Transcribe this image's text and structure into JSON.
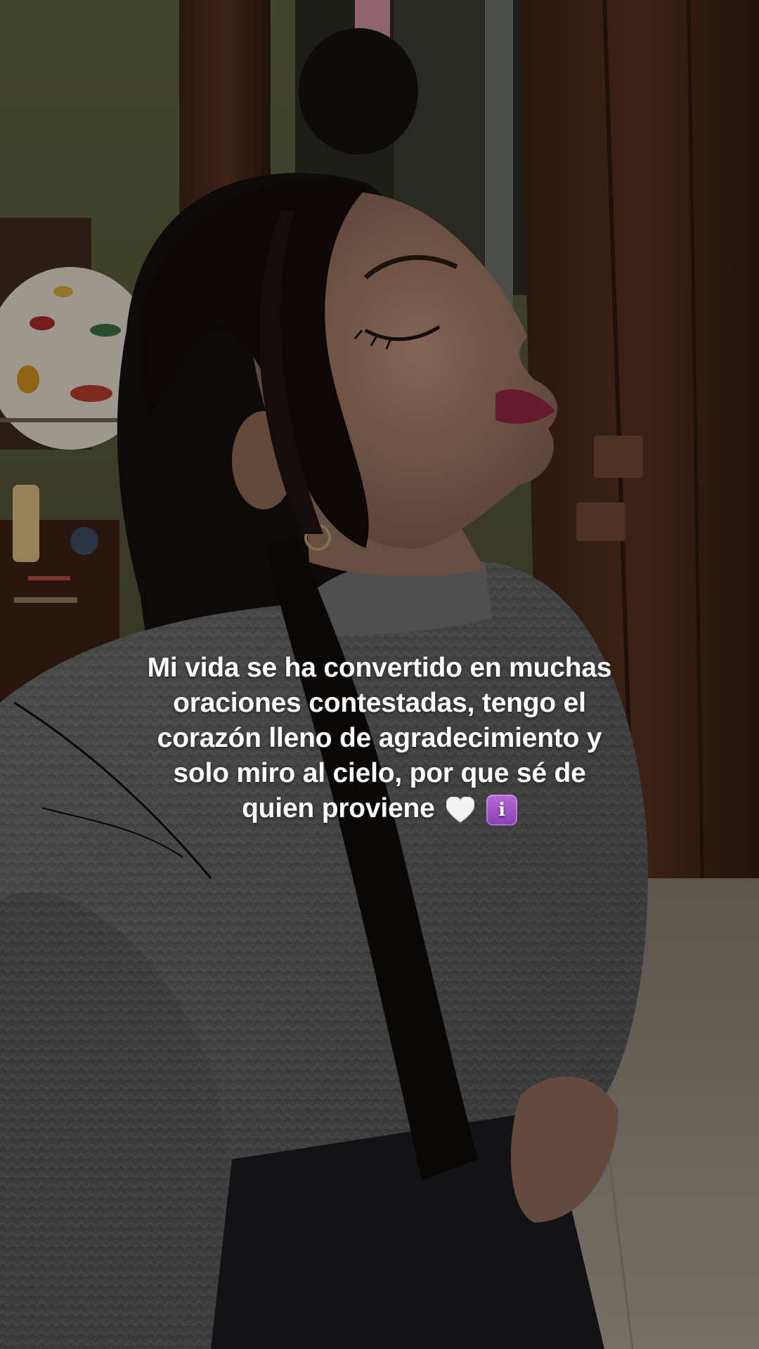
{
  "photo": {
    "scene": "photo-background",
    "palette": {
      "wall": "#565a3a",
      "curtain": "#4a2a1e",
      "sweater": "#5e5e5e",
      "hair": "#120d0c",
      "skin": "#a77f6c",
      "lips": "#8a2a44",
      "floor": "#8d867c"
    }
  },
  "caption": {
    "lines": [
      "Mi vida se ha convertido en muchas",
      "oraciones contestadas, tengo el",
      "corazón lleno de agradecimiento y",
      "solo miro al cielo, por que sé de",
      "quien proviene"
    ],
    "emojis": [
      "white-heart-icon",
      "info-icon"
    ],
    "info_glyph": "i",
    "color": "#ffffff"
  }
}
